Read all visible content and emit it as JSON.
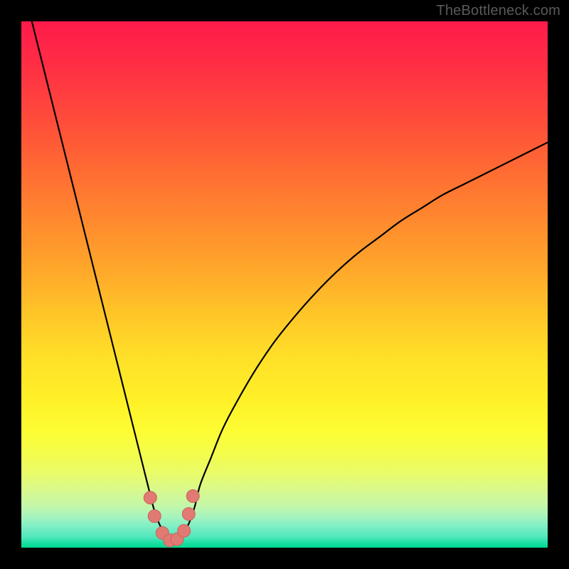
{
  "watermark": "TheBottleneck.com",
  "colors": {
    "background": "#000000",
    "curve_stroke": "#000000",
    "marker_fill": "#e07a72",
    "marker_stroke": "#c9655d"
  },
  "chart_data": {
    "type": "line",
    "title": "",
    "xlabel": "",
    "ylabel": "",
    "xlim": [
      0,
      100
    ],
    "ylim": [
      0,
      100
    ],
    "grid": false,
    "series": [
      {
        "name": "bottleneck-curve",
        "x": [
          0,
          2,
          4,
          6,
          8,
          10,
          12,
          14,
          16,
          18,
          20,
          22,
          24,
          25,
          26,
          27,
          28,
          29,
          30,
          31,
          32,
          33,
          34,
          36,
          38,
          40,
          44,
          48,
          52,
          56,
          60,
          64,
          68,
          72,
          76,
          80,
          84,
          88,
          92,
          96,
          100
        ],
        "values": [
          108,
          100,
          92,
          84,
          76,
          68,
          60,
          52,
          44,
          36,
          28,
          20,
          12,
          8,
          5,
          3,
          1.5,
          1,
          1.5,
          3,
          5,
          8,
          12,
          17,
          22,
          26,
          33,
          39,
          44,
          48.5,
          52.5,
          56,
          59,
          62,
          64.5,
          67,
          69,
          71,
          73,
          75,
          77
        ]
      }
    ],
    "markers": {
      "name": "highlight-points",
      "x": [
        24.5,
        25.3,
        26.8,
        28.2,
        29.6,
        30.9,
        31.8,
        32.6
      ],
      "values": [
        9.5,
        6.0,
        2.8,
        1.4,
        1.6,
        3.2,
        6.4,
        9.8
      ],
      "radius": 9
    }
  }
}
